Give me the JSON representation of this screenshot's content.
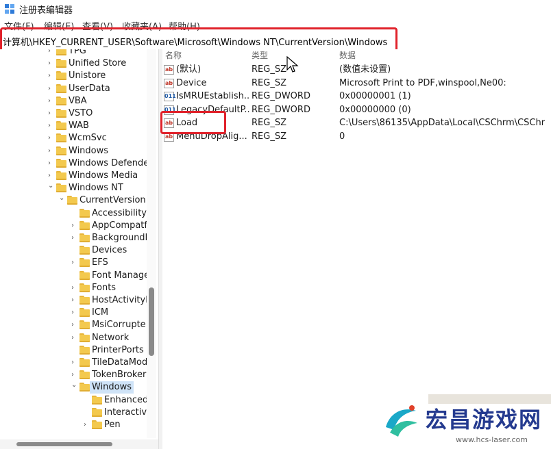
{
  "window": {
    "title": "注册表编辑器"
  },
  "menu": [
    "文件(F)",
    "编辑(E)",
    "查看(V)",
    "收藏夹(A)",
    "帮助(H)"
  ],
  "address": {
    "path": "计算机\\HKEY_CURRENT_USER\\Software\\Microsoft\\Windows NT\\CurrentVersion\\Windows"
  },
  "tree": {
    "items": [
      {
        "label": "TPG",
        "depth": 0,
        "expanded": false
      },
      {
        "label": "Unified Store",
        "depth": 0,
        "expanded": false
      },
      {
        "label": "Unistore",
        "depth": 0,
        "expanded": false
      },
      {
        "label": "UserData",
        "depth": 0,
        "expanded": false
      },
      {
        "label": "VBA",
        "depth": 0,
        "expanded": false
      },
      {
        "label": "VSTO",
        "depth": 0,
        "expanded": false
      },
      {
        "label": "WAB",
        "depth": 0,
        "expanded": false
      },
      {
        "label": "WcmSvc",
        "depth": 0,
        "expanded": false
      },
      {
        "label": "Windows",
        "depth": 0,
        "expanded": false
      },
      {
        "label": "Windows Defende",
        "depth": 0,
        "expanded": false
      },
      {
        "label": "Windows Media",
        "depth": 0,
        "expanded": false
      },
      {
        "label": "Windows NT",
        "depth": 0,
        "expanded": true
      },
      {
        "label": "CurrentVersion",
        "depth": 1,
        "expanded": true
      },
      {
        "label": "Accessibility",
        "depth": 2,
        "expanded": false,
        "leaf": true
      },
      {
        "label": "AppCompatf",
        "depth": 2,
        "expanded": false
      },
      {
        "label": "BackgroundI",
        "depth": 2,
        "expanded": false
      },
      {
        "label": "Devices",
        "depth": 2,
        "expanded": false,
        "leaf": true
      },
      {
        "label": "EFS",
        "depth": 2,
        "expanded": false
      },
      {
        "label": "Font Manage",
        "depth": 2,
        "expanded": false,
        "leaf": true
      },
      {
        "label": "Fonts",
        "depth": 2,
        "expanded": false
      },
      {
        "label": "HostActivityl",
        "depth": 2,
        "expanded": false
      },
      {
        "label": "ICM",
        "depth": 2,
        "expanded": false
      },
      {
        "label": "MsiCorrupte",
        "depth": 2,
        "expanded": false
      },
      {
        "label": "Network",
        "depth": 2,
        "expanded": false
      },
      {
        "label": "PrinterPorts",
        "depth": 2,
        "expanded": false,
        "leaf": true
      },
      {
        "label": "TileDataMod",
        "depth": 2,
        "expanded": false
      },
      {
        "label": "TokenBroker",
        "depth": 2,
        "expanded": false
      },
      {
        "label": "Windows",
        "depth": 2,
        "expanded": true,
        "selected": true
      },
      {
        "label": "Enhanced",
        "depth": 3,
        "expanded": false,
        "leaf": true
      },
      {
        "label": "Interactiv",
        "depth": 3,
        "expanded": false,
        "leaf": true
      },
      {
        "label": "Pen",
        "depth": 3,
        "expanded": false
      }
    ]
  },
  "list": {
    "columns": [
      "名称",
      "类型",
      "数据"
    ],
    "rows": [
      {
        "name": "(默认)",
        "type": "REG_SZ",
        "data": "(数值未设置)",
        "icon": "string-value-icon"
      },
      {
        "name": "Device",
        "type": "REG_SZ",
        "data": "Microsoft Print to PDF,winspool,Ne00:",
        "icon": "string-value-icon"
      },
      {
        "name": "IsMRUEstablish...",
        "type": "REG_DWORD",
        "data": "0x00000001 (1)",
        "icon": "dword-value-icon"
      },
      {
        "name": "LegacyDefaultP...",
        "type": "REG_DWORD",
        "data": "0x00000000 (0)",
        "icon": "dword-value-icon"
      },
      {
        "name": "Load",
        "type": "REG_SZ",
        "data": "C:\\Users\\86135\\AppData\\Local\\CSChrm\\CSChr...",
        "icon": "string-value-icon"
      },
      {
        "name": "MenuDropAlig...",
        "type": "REG_SZ",
        "data": "0",
        "icon": "string-value-icon"
      }
    ]
  },
  "watermark": {
    "name": "宏昌游戏网",
    "url": "www.hcs-laser.com"
  },
  "colors": {
    "highlight": "#e0212a",
    "folder": "#f3c94e",
    "selection": "#cfe3f7",
    "brand": "#243a8f"
  }
}
